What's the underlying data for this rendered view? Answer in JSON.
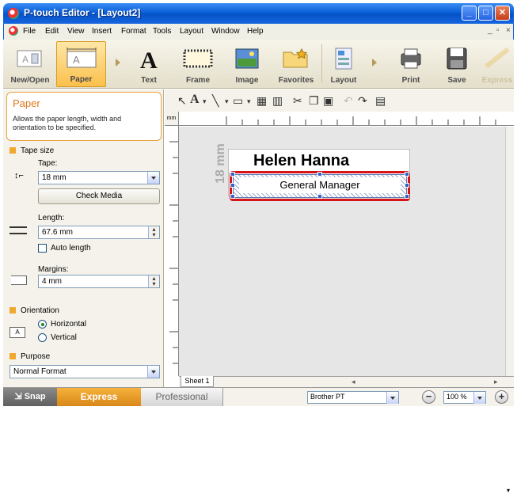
{
  "window": {
    "title": "P-touch Editor - [Layout2]",
    "min_icon": "minimize-icon",
    "max_icon": "maximize-icon",
    "close_icon": "close-icon",
    "mdi_controls": "_ ̅ ×"
  },
  "menu": {
    "items": [
      "File",
      "Edit",
      "View",
      "Insert",
      "Format",
      "Tools",
      "Layout",
      "Window",
      "Help"
    ]
  },
  "ribbon": {
    "new_open": "New/Open",
    "paper": "Paper",
    "text": "Text",
    "frame": "Frame",
    "image": "Image",
    "favorites": "Favorites",
    "layout": "Layout",
    "print": "Print",
    "save": "Save",
    "express": "Express"
  },
  "panel": {
    "title": "Paper",
    "description": "Allows the paper length, width and orientation to be specified.",
    "tape_size_header": "Tape size",
    "tape_label": "Tape:",
    "tape_value": "18 mm",
    "check_media": "Check Media",
    "length_label": "Length:",
    "length_value": "67.6 mm",
    "auto_length": "Auto length",
    "margins_label": "Margins:",
    "margins_value": "4 mm",
    "orientation_header": "Orientation",
    "horizontal": "Horizontal",
    "vertical": "Vertical",
    "purpose_header": "Purpose",
    "purpose_value": "Normal Format",
    "orientation_icon_text": "A"
  },
  "canvas": {
    "label_name": "Helen Hanna",
    "label_title": "General Manager",
    "tape_width_text": "18 mm",
    "sheet_tab": "Sheet 1",
    "ruler_unit": "mm"
  },
  "status": {
    "snap": "Snap",
    "express": "Express",
    "professional": "Professional",
    "printer": "Brother PT",
    "zoom": "100 %"
  },
  "colors": {
    "accent_orange": "#f0a830",
    "selection_red": "#d6151b",
    "title_blue": "#0a5fd8"
  }
}
